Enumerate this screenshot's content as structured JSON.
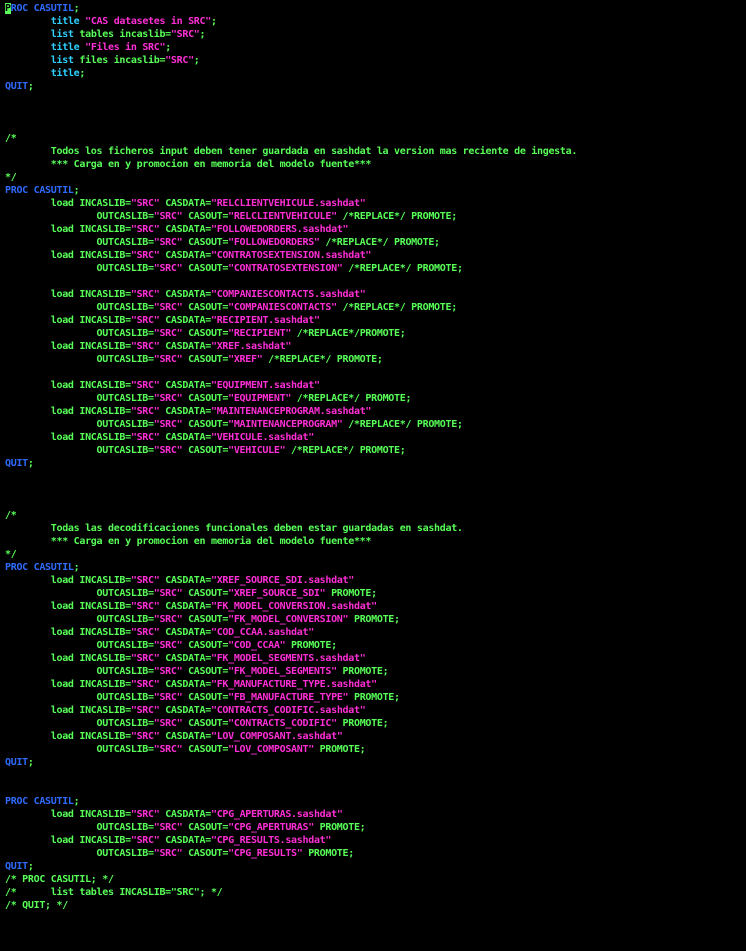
{
  "colors": {
    "background": "#000000",
    "keyword": "#2f6bff",
    "statement": "#2fd0ff",
    "string": "#ff2fd6",
    "default": "#58ff58",
    "comment": "#58ff58",
    "cursor": "#58ff58"
  },
  "code": [
    [
      [
        "cur",
        "P"
      ],
      [
        "kw",
        "ROC CASUTIL"
      ],
      [
        "dflt",
        ";"
      ]
    ],
    [
      [
        "dflt",
        "        "
      ],
      [
        "stmt",
        "title"
      ],
      [
        "dflt",
        " "
      ],
      [
        "str",
        "\"CAS datasetes in SRC\""
      ],
      [
        "dflt",
        ";"
      ]
    ],
    [
      [
        "dflt",
        "        "
      ],
      [
        "stmt",
        "list"
      ],
      [
        "dflt",
        " tables incaslib="
      ],
      [
        "str",
        "\"SRC\""
      ],
      [
        "dflt",
        ";"
      ]
    ],
    [
      [
        "dflt",
        "        "
      ],
      [
        "stmt",
        "title"
      ],
      [
        "dflt",
        " "
      ],
      [
        "str",
        "\"Files in SRC\""
      ],
      [
        "dflt",
        ";"
      ]
    ],
    [
      [
        "dflt",
        "        "
      ],
      [
        "stmt",
        "list"
      ],
      [
        "dflt",
        " files incaslib="
      ],
      [
        "str",
        "\"SRC\""
      ],
      [
        "dflt",
        ";"
      ]
    ],
    [
      [
        "dflt",
        "        "
      ],
      [
        "stmt",
        "title"
      ],
      [
        "dflt",
        ";"
      ]
    ],
    [
      [
        "kw",
        "QUIT"
      ],
      [
        "dflt",
        ";"
      ]
    ],
    [],
    [],
    [],
    [
      [
        "com",
        "/*"
      ]
    ],
    [
      [
        "com",
        "        Todos los ficheros input deben tener guardada en sashdat la version mas reciente de ingesta."
      ]
    ],
    [
      [
        "com",
        "        *** Carga en y promocion en memoria del modelo fuente***"
      ]
    ],
    [
      [
        "com",
        "*/"
      ]
    ],
    [
      [
        "kw",
        "PROC CASUTIL"
      ],
      [
        "dflt",
        ";"
      ]
    ],
    [
      [
        "dflt",
        "        load INCASLIB="
      ],
      [
        "str",
        "\"SRC\""
      ],
      [
        "dflt",
        " CASDATA="
      ],
      [
        "str",
        "\"RELCLIENTVEHICULE.sashdat\""
      ]
    ],
    [
      [
        "dflt",
        "                OUTCASLIB="
      ],
      [
        "str",
        "\"SRC\""
      ],
      [
        "dflt",
        " CASOUT="
      ],
      [
        "str",
        "\"RELCLIENTVEHICULE\""
      ],
      [
        "dflt",
        " /*REPLACE*/ PROMOTE;"
      ]
    ],
    [
      [
        "dflt",
        "        load INCASLIB="
      ],
      [
        "str",
        "\"SRC\""
      ],
      [
        "dflt",
        " CASDATA="
      ],
      [
        "str",
        "\"FOLLOWEDORDERS.sashdat\""
      ]
    ],
    [
      [
        "dflt",
        "                OUTCASLIB="
      ],
      [
        "str",
        "\"SRC\""
      ],
      [
        "dflt",
        " CASOUT="
      ],
      [
        "str",
        "\"FOLLOWEDORDERS\""
      ],
      [
        "dflt",
        " /*REPLACE*/ PROMOTE;"
      ]
    ],
    [
      [
        "dflt",
        "        load INCASLIB="
      ],
      [
        "str",
        "\"SRC\""
      ],
      [
        "dflt",
        " CASDATA="
      ],
      [
        "str",
        "\"CONTRATOSEXTENSION.sashdat\""
      ]
    ],
    [
      [
        "dflt",
        "                OUTCASLIB="
      ],
      [
        "str",
        "\"SRC\""
      ],
      [
        "dflt",
        " CASOUT="
      ],
      [
        "str",
        "\"CONTRATOSEXTENSION\""
      ],
      [
        "dflt",
        " /*REPLACE*/ PROMOTE;"
      ]
    ],
    [],
    [
      [
        "dflt",
        "        load INCASLIB="
      ],
      [
        "str",
        "\"SRC\""
      ],
      [
        "dflt",
        " CASDATA="
      ],
      [
        "str",
        "\"COMPANIESCONTACTS.sashdat\""
      ]
    ],
    [
      [
        "dflt",
        "                OUTCASLIB="
      ],
      [
        "str",
        "\"SRC\""
      ],
      [
        "dflt",
        " CASOUT="
      ],
      [
        "str",
        "\"COMPANIESCONTACTS\""
      ],
      [
        "dflt",
        " /*REPLACE*/ PROMOTE;"
      ]
    ],
    [
      [
        "dflt",
        "        load INCASLIB="
      ],
      [
        "str",
        "\"SRC\""
      ],
      [
        "dflt",
        " CASDATA="
      ],
      [
        "str",
        "\"RECIPIENT.sashdat\""
      ]
    ],
    [
      [
        "dflt",
        "                OUTCASLIB="
      ],
      [
        "str",
        "\"SRC\""
      ],
      [
        "dflt",
        " CASOUT="
      ],
      [
        "str",
        "\"RECIPIENT\""
      ],
      [
        "dflt",
        " /*REPLACE*/PROMOTE;"
      ]
    ],
    [
      [
        "dflt",
        "        load INCASLIB="
      ],
      [
        "str",
        "\"SRC\""
      ],
      [
        "dflt",
        " CASDATA="
      ],
      [
        "str",
        "\"XREF.sashdat\""
      ]
    ],
    [
      [
        "dflt",
        "                OUTCASLIB="
      ],
      [
        "str",
        "\"SRC\""
      ],
      [
        "dflt",
        " CASOUT="
      ],
      [
        "str",
        "\"XREF\""
      ],
      [
        "dflt",
        " /*REPLACE*/ PROMOTE;"
      ]
    ],
    [],
    [
      [
        "dflt",
        "        load INCASLIB="
      ],
      [
        "str",
        "\"SRC\""
      ],
      [
        "dflt",
        " CASDATA="
      ],
      [
        "str",
        "\"EQUIPMENT.sashdat\""
      ]
    ],
    [
      [
        "dflt",
        "                OUTCASLIB="
      ],
      [
        "str",
        "\"SRC\""
      ],
      [
        "dflt",
        " CASOUT="
      ],
      [
        "str",
        "\"EQUIPMENT\""
      ],
      [
        "dflt",
        " /*REPLACE*/ PROMOTE;"
      ]
    ],
    [
      [
        "dflt",
        "        load INCASLIB="
      ],
      [
        "str",
        "\"SRC\""
      ],
      [
        "dflt",
        " CASDATA="
      ],
      [
        "str",
        "\"MAINTENANCEPROGRAM.sashdat\""
      ]
    ],
    [
      [
        "dflt",
        "                OUTCASLIB="
      ],
      [
        "str",
        "\"SRC\""
      ],
      [
        "dflt",
        " CASOUT="
      ],
      [
        "str",
        "\"MAINTENANCEPROGRAM\""
      ],
      [
        "dflt",
        " /*REPLACE*/ PROMOTE;"
      ]
    ],
    [
      [
        "dflt",
        "        load INCASLIB="
      ],
      [
        "str",
        "\"SRC\""
      ],
      [
        "dflt",
        " CASDATA="
      ],
      [
        "str",
        "\"VEHICULE.sashdat\""
      ]
    ],
    [
      [
        "dflt",
        "                OUTCASLIB="
      ],
      [
        "str",
        "\"SRC\""
      ],
      [
        "dflt",
        " CASOUT="
      ],
      [
        "str",
        "\"VEHICULE\""
      ],
      [
        "dflt",
        " /*REPLACE*/ PROMOTE;"
      ]
    ],
    [
      [
        "kw",
        "QUIT"
      ],
      [
        "dflt",
        ";"
      ]
    ],
    [],
    [],
    [],
    [
      [
        "com",
        "/*"
      ]
    ],
    [
      [
        "com",
        "        Todas las decodificaciones funcionales deben estar guardadas en sashdat."
      ]
    ],
    [
      [
        "com",
        "        *** Carga en y promocion en memoria del modelo fuente***"
      ]
    ],
    [
      [
        "com",
        "*/"
      ]
    ],
    [
      [
        "kw",
        "PROC CASUTIL"
      ],
      [
        "dflt",
        ";"
      ]
    ],
    [
      [
        "dflt",
        "        load INCASLIB="
      ],
      [
        "str",
        "\"SRC\""
      ],
      [
        "dflt",
        " CASDATA="
      ],
      [
        "str",
        "\"XREF_SOURCE_SDI.sashdat\""
      ]
    ],
    [
      [
        "dflt",
        "                OUTCASLIB="
      ],
      [
        "str",
        "\"SRC\""
      ],
      [
        "dflt",
        " CASOUT="
      ],
      [
        "str",
        "\"XREF_SOURCE_SDI\""
      ],
      [
        "dflt",
        " PROMOTE;"
      ]
    ],
    [
      [
        "dflt",
        "        load INCASLIB="
      ],
      [
        "str",
        "\"SRC\""
      ],
      [
        "dflt",
        " CASDATA="
      ],
      [
        "str",
        "\"FK_MODEL_CONVERSION.sashdat\""
      ]
    ],
    [
      [
        "dflt",
        "                OUTCASLIB="
      ],
      [
        "str",
        "\"SRC\""
      ],
      [
        "dflt",
        " CASOUT="
      ],
      [
        "str",
        "\"FK_MODEL_CONVERSION\""
      ],
      [
        "dflt",
        " PROMOTE;"
      ]
    ],
    [
      [
        "dflt",
        "        load INCASLIB="
      ],
      [
        "str",
        "\"SRC\""
      ],
      [
        "dflt",
        " CASDATA="
      ],
      [
        "str",
        "\"COD_CCAA.sashdat\""
      ]
    ],
    [
      [
        "dflt",
        "                OUTCASLIB="
      ],
      [
        "str",
        "\"SRC\""
      ],
      [
        "dflt",
        " CASOUT="
      ],
      [
        "str",
        "\"COD_CCAA\""
      ],
      [
        "dflt",
        " PROMOTE;"
      ]
    ],
    [
      [
        "dflt",
        "        load INCASLIB="
      ],
      [
        "str",
        "\"SRC\""
      ],
      [
        "dflt",
        " CASDATA="
      ],
      [
        "str",
        "\"FK_MODEL_SEGMENTS.sashdat\""
      ]
    ],
    [
      [
        "dflt",
        "                OUTCASLIB="
      ],
      [
        "str",
        "\"SRC\""
      ],
      [
        "dflt",
        " CASOUT="
      ],
      [
        "str",
        "\"FK_MODEL_SEGMENTS\""
      ],
      [
        "dflt",
        " PROMOTE;"
      ]
    ],
    [
      [
        "dflt",
        "        load INCASLIB="
      ],
      [
        "str",
        "\"SRC\""
      ],
      [
        "dflt",
        " CASDATA="
      ],
      [
        "str",
        "\"FK_MANUFACTURE_TYPE.sashdat\""
      ]
    ],
    [
      [
        "dflt",
        "                OUTCASLIB="
      ],
      [
        "str",
        "\"SRC\""
      ],
      [
        "dflt",
        " CASOUT="
      ],
      [
        "str",
        "\"FB_MANUFACTURE_TYPE\""
      ],
      [
        "dflt",
        " PROMOTE;"
      ]
    ],
    [
      [
        "dflt",
        "        load INCASLIB="
      ],
      [
        "str",
        "\"SRC\""
      ],
      [
        "dflt",
        " CASDATA="
      ],
      [
        "str",
        "\"CONTRACTS_CODIFIC.sashdat\""
      ]
    ],
    [
      [
        "dflt",
        "                OUTCASLIB="
      ],
      [
        "str",
        "\"SRC\""
      ],
      [
        "dflt",
        " CASOUT="
      ],
      [
        "str",
        "\"CONTRACTS_CODIFIC\""
      ],
      [
        "dflt",
        " PROMOTE;"
      ]
    ],
    [
      [
        "dflt",
        "        load INCASLIB="
      ],
      [
        "str",
        "\"SRC\""
      ],
      [
        "dflt",
        " CASDATA="
      ],
      [
        "str",
        "\"LOV_COMPOSANT.sashdat\""
      ]
    ],
    [
      [
        "dflt",
        "                OUTCASLIB="
      ],
      [
        "str",
        "\"SRC\""
      ],
      [
        "dflt",
        " CASOUT="
      ],
      [
        "str",
        "\"LOV_COMPOSANT\""
      ],
      [
        "dflt",
        " PROMOTE;"
      ]
    ],
    [
      [
        "kw",
        "QUIT"
      ],
      [
        "dflt",
        ";"
      ]
    ],
    [],
    [],
    [
      [
        "kw",
        "PROC CASUTIL"
      ],
      [
        "dflt",
        ";"
      ]
    ],
    [
      [
        "dflt",
        "        load INCASLIB="
      ],
      [
        "str",
        "\"SRC\""
      ],
      [
        "dflt",
        " CASDATA="
      ],
      [
        "str",
        "\"CPG_APERTURAS.sashdat\""
      ]
    ],
    [
      [
        "dflt",
        "                OUTCASLIB="
      ],
      [
        "str",
        "\"SRC\""
      ],
      [
        "dflt",
        " CASOUT="
      ],
      [
        "str",
        "\"CPG_APERTURAS\""
      ],
      [
        "dflt",
        " PROMOTE;"
      ]
    ],
    [
      [
        "dflt",
        "        load INCASLIB="
      ],
      [
        "str",
        "\"SRC\""
      ],
      [
        "dflt",
        " CASDATA="
      ],
      [
        "str",
        "\"CPG_RESULTS.sashdat\""
      ]
    ],
    [
      [
        "dflt",
        "                OUTCASLIB="
      ],
      [
        "str",
        "\"SRC\""
      ],
      [
        "dflt",
        " CASOUT="
      ],
      [
        "str",
        "\"CPG_RESULTS\""
      ],
      [
        "dflt",
        " PROMOTE;"
      ]
    ],
    [
      [
        "kw",
        "QUIT"
      ],
      [
        "dflt",
        ";"
      ]
    ],
    [
      [
        "com",
        "/* PROC CASUTIL; */"
      ]
    ],
    [
      [
        "com",
        "/*      list tables INCASLIB=\"SRC\"; */"
      ]
    ],
    [
      [
        "com",
        "/* QUIT; */"
      ]
    ]
  ]
}
